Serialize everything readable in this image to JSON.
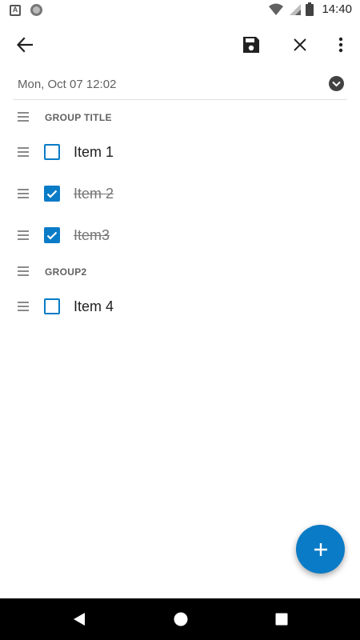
{
  "status_bar": {
    "notif_a_icon": "A",
    "time": "14:40"
  },
  "toolbar": {
    "back_icon": "arrow-left",
    "save_icon": "floppy-disk",
    "close_icon": "close-x",
    "more_icon": "vertical-dots"
  },
  "date_row": {
    "text": "Mon, Oct 07 12:02"
  },
  "list": [
    {
      "type": "group",
      "label": "GROUP TITLE"
    },
    {
      "type": "item",
      "label": "Item 1",
      "checked": false
    },
    {
      "type": "item",
      "label": "Item 2",
      "checked": true
    },
    {
      "type": "item",
      "label": "Item3",
      "checked": true
    },
    {
      "type": "group",
      "label": "GROUP2"
    },
    {
      "type": "item",
      "label": "Item 4",
      "checked": false
    }
  ],
  "fab": {
    "icon": "plus"
  },
  "colors": {
    "accent": "#0a7bc6",
    "navbar": "#000000",
    "done_text": "#757575"
  }
}
